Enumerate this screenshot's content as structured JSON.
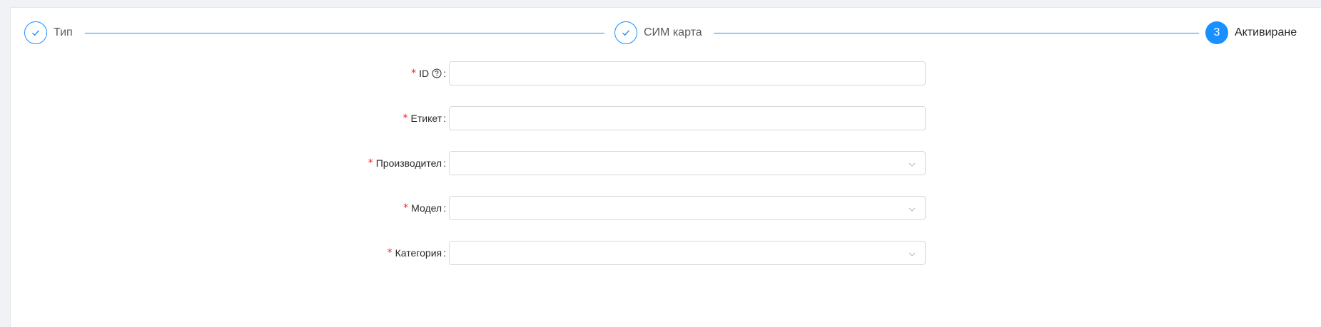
{
  "steps": [
    {
      "label": "Тип",
      "status": "finished",
      "icon": "check-icon"
    },
    {
      "label": "СИМ карта",
      "status": "finished",
      "icon": "check-icon"
    },
    {
      "label": "Активиране",
      "status": "process",
      "number": "3"
    }
  ],
  "form": {
    "fields": [
      {
        "label": "ID",
        "required": true,
        "type": "input",
        "value": "",
        "help_icon": "question-circle-icon"
      },
      {
        "label": "Етикет",
        "required": true,
        "type": "input",
        "value": ""
      },
      {
        "label": "Производител",
        "required": true,
        "type": "select",
        "value": "",
        "arrow_icon": "chevron-down-icon"
      },
      {
        "label": "Модел",
        "required": true,
        "type": "select",
        "value": "",
        "arrow_icon": "chevron-down-icon"
      },
      {
        "label": "Категория",
        "required": true,
        "type": "select",
        "value": "",
        "arrow_icon": "chevron-down-icon"
      }
    ],
    "required_mark": "*",
    "colon": ":"
  },
  "colors": {
    "primary": "#1890ff",
    "required": "#f5222d",
    "border": "#d9d9d9"
  }
}
